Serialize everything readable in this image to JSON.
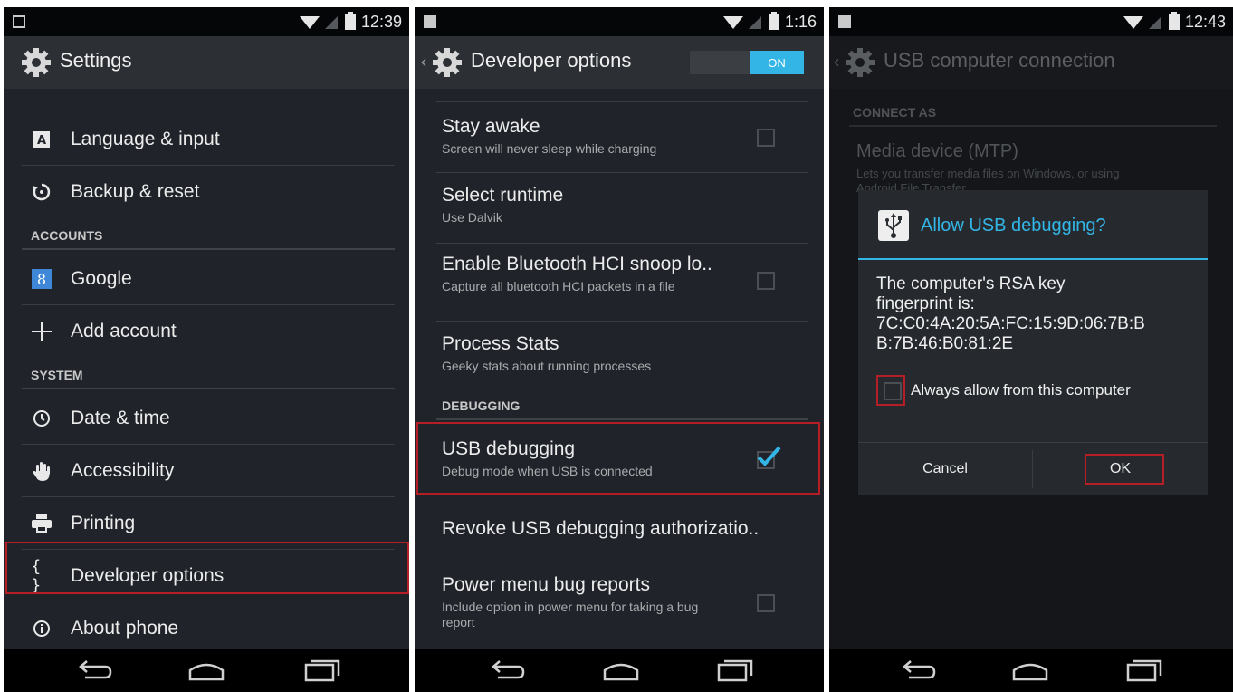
{
  "screens": [
    {
      "status": {
        "time": "12:39"
      },
      "title": "Settings",
      "items": [
        {
          "label": "Language & input",
          "icon": "keyboard-a-icon"
        },
        {
          "label": "Backup & reset",
          "icon": "backup-restore-icon"
        },
        {
          "header": "ACCOUNTS"
        },
        {
          "label": "Google",
          "icon": "google-g-icon"
        },
        {
          "label": "Add account",
          "icon": "plus-icon"
        },
        {
          "header": "SYSTEM"
        },
        {
          "label": "Date & time",
          "icon": "clock-icon"
        },
        {
          "label": "Accessibility",
          "icon": "hand-icon"
        },
        {
          "label": "Printing",
          "icon": "printer-icon"
        },
        {
          "label": "Developer options",
          "icon": "braces-icon"
        },
        {
          "label": "About phone",
          "icon": "info-icon"
        }
      ],
      "highlighted": "Developer options"
    },
    {
      "status": {
        "time": "1:16"
      },
      "title": "Developer options",
      "toggle": "ON",
      "items": [
        {
          "title": "Stay awake",
          "subtitle": "Screen will never sleep while charging",
          "checked": false
        },
        {
          "title": "Select runtime",
          "subtitle": "Use Dalvik"
        },
        {
          "title": "Enable Bluetooth HCI snoop lo..",
          "subtitle": "Capture all bluetooth HCI packets in a file",
          "checked": false
        },
        {
          "title": "Process Stats",
          "subtitle": "Geeky stats about running processes"
        },
        {
          "header": "DEBUGGING"
        },
        {
          "title": "USB debugging",
          "subtitle": "Debug mode when USB is connected",
          "checked": true
        },
        {
          "title": "Revoke USB debugging authorizatio.."
        },
        {
          "title": "Power menu bug reports",
          "subtitle": "Include option in power menu for taking a bug report",
          "checked": false
        }
      ],
      "highlighted": "USB debugging"
    },
    {
      "status": {
        "time": "12:43"
      },
      "title": "USB computer connection",
      "background": {
        "header": "CONNECT AS",
        "option_title": "Media device (MTP)",
        "option_sub": "Lets you transfer media files on Windows, or using Android File Transfer"
      },
      "dialog": {
        "title": "Allow USB debugging?",
        "message_line1": "The computer's RSA key",
        "message_line2": "fingerprint is:",
        "message_line3": "7C:C0:4A:20:5A:FC:15:9D:06:7B:B",
        "message_line4": "B:7B:46:B0:81:2E",
        "checkbox_label": "Always allow from this computer",
        "always_allow_checked": false,
        "cancel": "Cancel",
        "ok": "OK"
      }
    }
  ],
  "colors": {
    "accent": "#33b5e5",
    "highlight": "#b51e24",
    "background": "#20242a"
  }
}
